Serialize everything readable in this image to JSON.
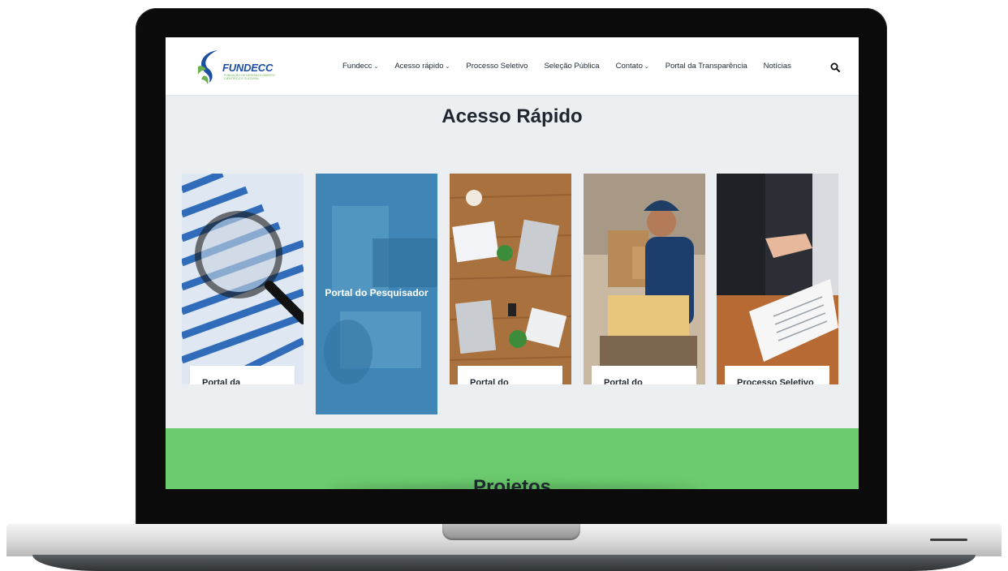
{
  "logo": {
    "name": "FUNDECC",
    "tagline": "FUNDAÇÃO DE DESENVOLVIMENTO CIENTÍFICO E CULTURAL"
  },
  "nav": {
    "items": [
      {
        "label": "Fundecc",
        "has_dropdown": true
      },
      {
        "label": "Acesso rápido",
        "has_dropdown": true
      },
      {
        "label": "Processo Seletivo",
        "has_dropdown": false
      },
      {
        "label": "Seleção Pública",
        "has_dropdown": false
      },
      {
        "label": "Contato",
        "has_dropdown": true
      },
      {
        "label": "Portal da Transparência",
        "has_dropdown": false
      },
      {
        "label": "Notícias",
        "has_dropdown": false
      }
    ],
    "search_icon": "search-icon"
  },
  "quick_access": {
    "title": "Acesso Rápido",
    "cards": [
      {
        "label": "Portal da Transparência"
      },
      {
        "label": "Portal do Pesquisador"
      },
      {
        "label": "Portal do Colaborador"
      },
      {
        "label": "Portal do Fornecedor"
      },
      {
        "label": "Processo Seletivo"
      }
    ]
  },
  "projects": {
    "title": "Projetos"
  },
  "colors": {
    "brand_blue": "#1c4fa0",
    "brand_green": "#6ccb6e",
    "feature_card": "#3a7ca8",
    "page_bg": "#eceff2"
  }
}
